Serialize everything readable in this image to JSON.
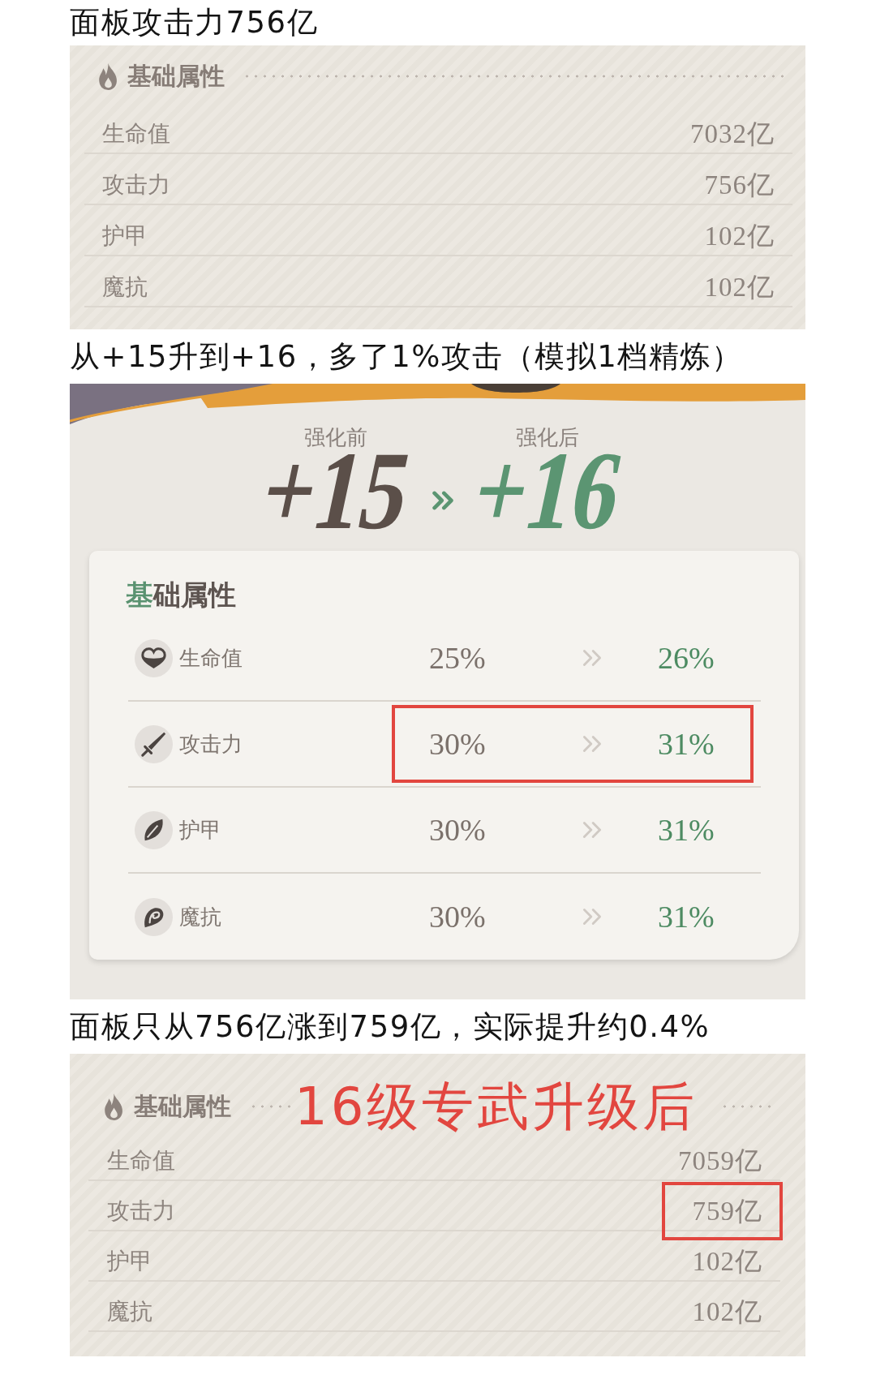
{
  "before_panel": {
    "caption": "面板攻击力756亿",
    "title": "基础属性",
    "rows": [
      {
        "label": "生命值",
        "value": "7032亿",
        "highlighted": false
      },
      {
        "label": "攻击力",
        "value": "756亿",
        "highlighted": false
      },
      {
        "label": "护甲",
        "value": "102亿",
        "highlighted": false
      },
      {
        "label": "魔抗",
        "value": "102亿",
        "highlighted": false
      }
    ]
  },
  "upgrade": {
    "caption": "从+15升到+16，多了1%攻击（模拟1档精炼）",
    "before": {
      "label": "强化前",
      "level": "+15"
    },
    "after": {
      "label": "强化后",
      "level": "+16"
    },
    "card_title": "基础属性",
    "rows": [
      {
        "kind": "health",
        "label": "生命值",
        "before": "25%",
        "after": "26%",
        "highlighted": false
      },
      {
        "kind": "attack",
        "label": "攻击力",
        "before": "30%",
        "after": "31%",
        "highlighted": true
      },
      {
        "kind": "armor",
        "label": "护甲",
        "before": "30%",
        "after": "31%",
        "highlighted": false
      },
      {
        "kind": "resist",
        "label": "魔抗",
        "before": "30%",
        "after": "31%",
        "highlighted": false
      }
    ]
  },
  "after_panel": {
    "caption": "面板只从756亿涨到759亿，实际提升约0.4%",
    "title": "基础属性",
    "annotation": "16级专武升级后",
    "rows": [
      {
        "label": "生命值",
        "value": "7059亿",
        "highlighted": false
      },
      {
        "label": "攻击力",
        "value": "759亿",
        "highlighted": true
      },
      {
        "label": "护甲",
        "value": "102亿",
        "highlighted": false
      },
      {
        "label": "魔抗",
        "value": "102亿",
        "highlighted": false
      }
    ]
  }
}
